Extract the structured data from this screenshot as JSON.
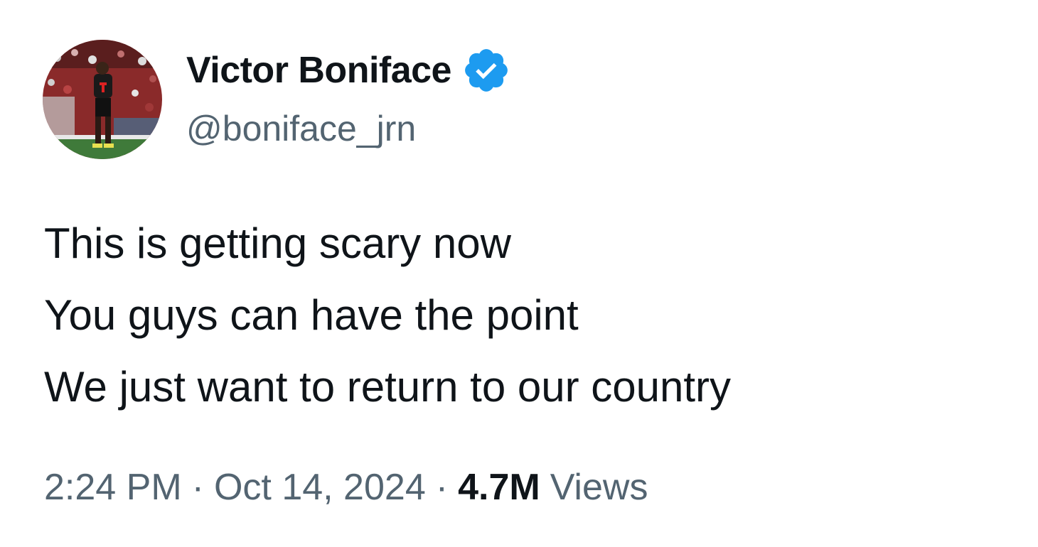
{
  "tweet": {
    "author": {
      "display_name": "Victor Boniface",
      "handle": "@boniface_jrn",
      "verified": true,
      "avatar_icon": "profile-photo-footballer"
    },
    "body_lines": [
      "This is getting scary now",
      "You guys can have the point",
      "We just want to return to our country"
    ],
    "meta": {
      "time": "2:24 PM",
      "separator": "·",
      "date": "Oct 14, 2024",
      "views_count": "4.7M",
      "views_label": "Views"
    },
    "colors": {
      "text_primary": "#0f1419",
      "text_secondary": "#536471",
      "verified_blue": "#1d9bf0",
      "background": "#ffffff"
    }
  }
}
